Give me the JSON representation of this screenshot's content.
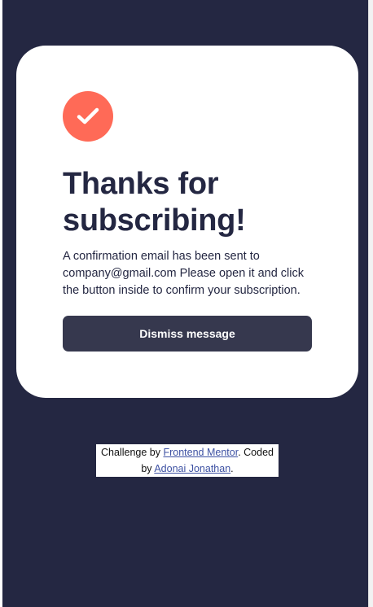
{
  "colors": {
    "page_background": "#242742",
    "card_background": "#ffffff",
    "accent": "#ff6a57",
    "button_background": "#36384e",
    "text_primary": "#242742",
    "link": "#3e52a3"
  },
  "success": {
    "icon": "check-icon"
  },
  "card": {
    "title": "Thanks for subscribing!",
    "message": "A confirmation email has been sent to company@gmail.com Please open it and click the button inside to confirm your subscription."
  },
  "actions": {
    "dismiss_label": "Dismiss message"
  },
  "attribution": {
    "prefix": "Challenge by ",
    "challenge_link": "Frontend Mentor",
    "middle": ". Coded by ",
    "author_link": "Adonai Jonathan",
    "suffix": "."
  }
}
